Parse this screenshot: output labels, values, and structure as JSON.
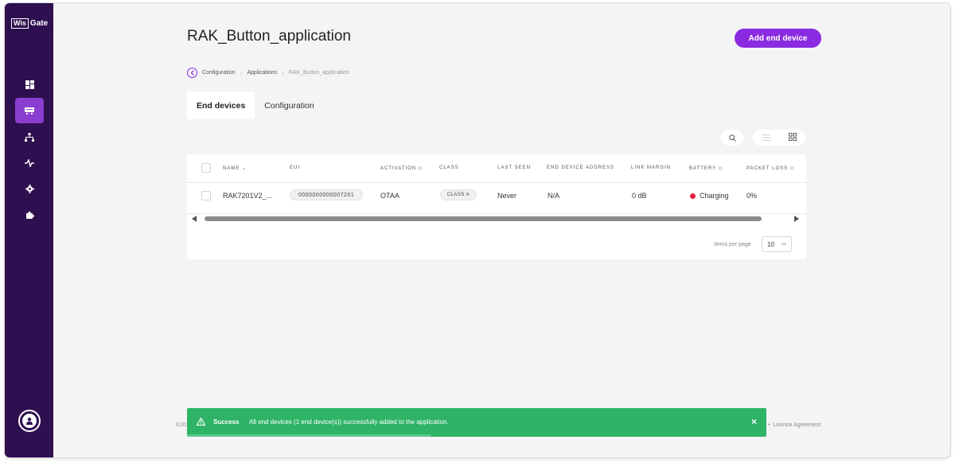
{
  "app": {
    "logo_box": "Wis",
    "logo_rest": "Gate"
  },
  "sidebar": {
    "items": [
      {
        "icon": "dashboard-icon",
        "active": false
      },
      {
        "icon": "gateway-icon",
        "active": true
      },
      {
        "icon": "network-icon",
        "active": false
      },
      {
        "icon": "activity-icon",
        "active": false
      },
      {
        "icon": "settings-icon",
        "active": false
      },
      {
        "icon": "extensions-icon",
        "active": false
      }
    ],
    "avatar_icon": "user-icon"
  },
  "header": {
    "title": "RAK_Button_application",
    "add_button": "Add end device"
  },
  "breadcrumb": {
    "items": [
      "Configuration",
      "Applications",
      "RAK_Button_application"
    ]
  },
  "tabs": [
    {
      "label": "End devices",
      "active": true
    },
    {
      "label": "Configuration",
      "active": false
    }
  ],
  "table": {
    "columns": [
      "NAME",
      "EUI",
      "ACTIVATION",
      "CLASS",
      "LAST SEEN",
      "END DEVICE ADDRESS",
      "LINK MARGIN",
      "BATTERY",
      "PACKET LOSS"
    ],
    "sort_down": "⌄",
    "sort_both": "◇",
    "rows": [
      {
        "name": "RAK7201V2_...",
        "eui": "0000000000007201",
        "activation": "OTAA",
        "class": "CLASS A",
        "last_seen": "Never",
        "address": "N/A",
        "link_margin": "0 dB",
        "battery": "Charging",
        "battery_color": "#e8213e",
        "packet_loss": "0%"
      }
    ]
  },
  "pagination": {
    "label": "Items per page",
    "value": "10"
  },
  "footer": {
    "left": "©20",
    "right": "Licence Agreement"
  },
  "toast": {
    "title": "Success",
    "message": "All end devices (1 end device(s)) successfully added to the application.",
    "close": "×",
    "progress": 0.42,
    "color": "#2fb366"
  },
  "colors": {
    "sidebar": "#2e0f4f",
    "accent": "#8a2be2"
  }
}
